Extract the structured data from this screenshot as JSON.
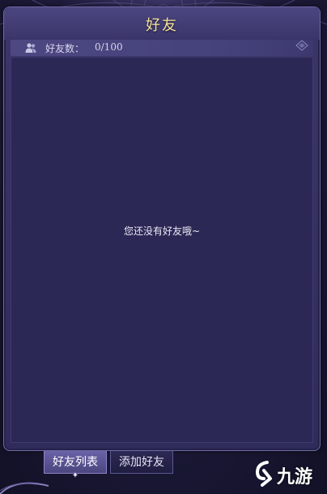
{
  "window": {
    "title": "好友"
  },
  "friends": {
    "count_label": "好友数：",
    "count_value": "0/100",
    "empty_message": "您还没有好友哦~"
  },
  "tabs": [
    {
      "label": "好友列表",
      "active": true
    },
    {
      "label": "添加好友",
      "active": false
    }
  ],
  "watermark": {
    "text": "九游"
  },
  "colors": {
    "title": "#f5e39a",
    "panel": "#2b2855",
    "accent": "#6963a8"
  },
  "icons": {
    "count": "users-icon",
    "corner": "corner-ornament-icon",
    "tab_indicator": "star-icon"
  }
}
